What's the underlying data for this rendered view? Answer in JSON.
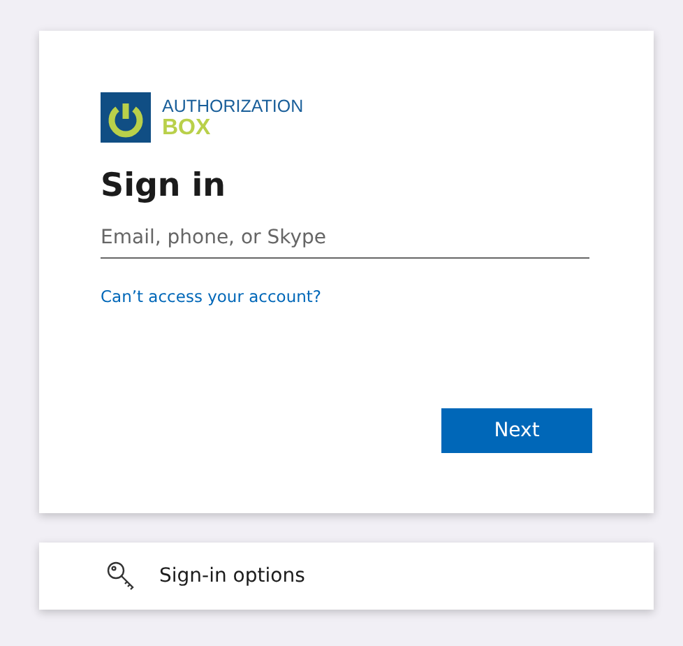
{
  "logo": {
    "line_1": "AUTHORIZATION",
    "line_2": "BOX"
  },
  "title": "Sign in",
  "email_field": {
    "placeholder": "Email, phone, or Skype"
  },
  "help_link": "Can’t access your account?",
  "next_button": "Next",
  "options": {
    "label": "Sign-in options"
  }
}
